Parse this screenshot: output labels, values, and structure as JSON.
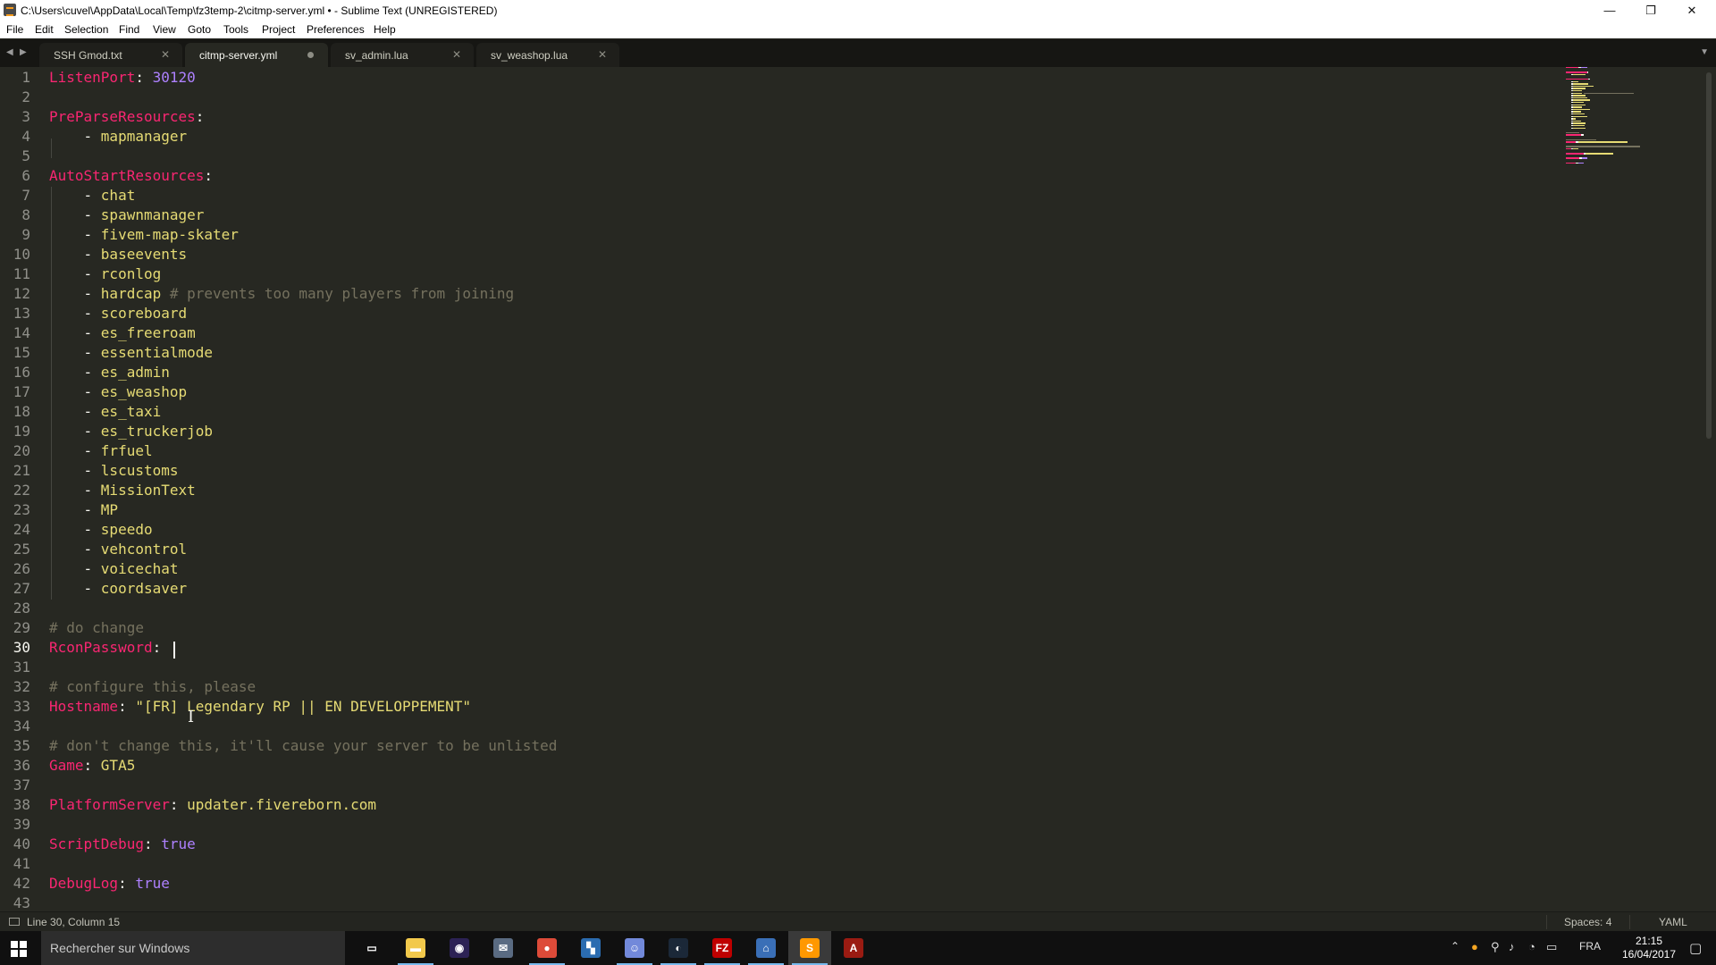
{
  "window": {
    "title": "C:\\Users\\cuvel\\AppData\\Local\\Temp\\fz3temp-2\\citmp-server.yml • - Sublime Text (UNREGISTERED)",
    "minimize_glyph": "—",
    "maximize_glyph": "❐",
    "close_glyph": "✕"
  },
  "menu": [
    "File",
    "Edit",
    "Selection",
    "Find",
    "View",
    "Goto",
    "Tools",
    "Project",
    "Preferences",
    "Help"
  ],
  "tabs": [
    {
      "label": "SSH Gmod.txt",
      "active": false,
      "dirty": false
    },
    {
      "label": "citmp-server.yml",
      "active": true,
      "dirty": true
    },
    {
      "label": "sv_admin.lua",
      "active": false,
      "dirty": false
    },
    {
      "label": "sv_weashop.lua",
      "active": false,
      "dirty": false
    }
  ],
  "editor": {
    "current_line": 30,
    "lines": [
      [
        [
          "k",
          "ListenPort"
        ],
        [
          "p",
          ": "
        ],
        [
          "n",
          "30120"
        ]
      ],
      [],
      [
        [
          "k",
          "PreParseResources"
        ],
        [
          "p",
          ":"
        ]
      ],
      [
        [
          "p",
          "    - "
        ],
        [
          "s",
          "mapmanager"
        ]
      ],
      [],
      [
        [
          "k",
          "AutoStartResources"
        ],
        [
          "p",
          ":"
        ]
      ],
      [
        [
          "p",
          "    - "
        ],
        [
          "s",
          "chat"
        ]
      ],
      [
        [
          "p",
          "    - "
        ],
        [
          "s",
          "spawnmanager"
        ]
      ],
      [
        [
          "p",
          "    - "
        ],
        [
          "s",
          "fivem-map-skater"
        ]
      ],
      [
        [
          "p",
          "    - "
        ],
        [
          "s",
          "baseevents"
        ]
      ],
      [
        [
          "p",
          "    - "
        ],
        [
          "s",
          "rconlog"
        ]
      ],
      [
        [
          "p",
          "    - "
        ],
        [
          "s",
          "hardcap"
        ],
        [
          "c",
          " # prevents too many players from joining"
        ]
      ],
      [
        [
          "p",
          "    - "
        ],
        [
          "s",
          "scoreboard"
        ]
      ],
      [
        [
          "p",
          "    - "
        ],
        [
          "s",
          "es_freeroam"
        ]
      ],
      [
        [
          "p",
          "    - "
        ],
        [
          "s",
          "essentialmode"
        ]
      ],
      [
        [
          "p",
          "    - "
        ],
        [
          "s",
          "es_admin"
        ]
      ],
      [
        [
          "p",
          "    - "
        ],
        [
          "s",
          "es_weashop"
        ]
      ],
      [
        [
          "p",
          "    - "
        ],
        [
          "s",
          "es_taxi"
        ]
      ],
      [
        [
          "p",
          "    - "
        ],
        [
          "s",
          "es_truckerjob"
        ]
      ],
      [
        [
          "p",
          "    - "
        ],
        [
          "s",
          "frfuel"
        ]
      ],
      [
        [
          "p",
          "    - "
        ],
        [
          "s",
          "lscustoms"
        ]
      ],
      [
        [
          "p",
          "    - "
        ],
        [
          "s",
          "MissionText"
        ]
      ],
      [
        [
          "p",
          "    - "
        ],
        [
          "s",
          "MP"
        ]
      ],
      [
        [
          "p",
          "    - "
        ],
        [
          "s",
          "speedo"
        ]
      ],
      [
        [
          "p",
          "    - "
        ],
        [
          "s",
          "vehcontrol"
        ]
      ],
      [
        [
          "p",
          "    - "
        ],
        [
          "s",
          "voicechat"
        ]
      ],
      [
        [
          "p",
          "    - "
        ],
        [
          "s",
          "coordsaver"
        ]
      ],
      [],
      [
        [
          "c",
          "# do change"
        ]
      ],
      [
        [
          "k",
          "RconPassword"
        ],
        [
          "p",
          ": "
        ]
      ],
      [],
      [
        [
          "c",
          "# configure this, please"
        ]
      ],
      [
        [
          "k",
          "Hostname"
        ],
        [
          "p",
          ": "
        ],
        [
          "s",
          "\"[FR] Legendary RP || EN DEVELOPPEMENT\""
        ]
      ],
      [],
      [
        [
          "c",
          "# don't change this, it'll cause your server to be unlisted"
        ]
      ],
      [
        [
          "k",
          "Game"
        ],
        [
          "p",
          ": "
        ],
        [
          "s",
          "GTA5"
        ]
      ],
      [],
      [
        [
          "k",
          "PlatformServer"
        ],
        [
          "p",
          ": "
        ],
        [
          "s",
          "updater.fivereborn.com"
        ]
      ],
      [],
      [
        [
          "k",
          "ScriptDebug"
        ],
        [
          "p",
          ": "
        ],
        [
          "n",
          "true"
        ]
      ],
      [],
      [
        [
          "k",
          "DebugLog"
        ],
        [
          "p",
          ": "
        ],
        [
          "n",
          "true"
        ]
      ],
      []
    ]
  },
  "colors": {
    "keyword": "#f92672",
    "string": "#e6db74",
    "number": "#ae81ff",
    "comment": "#75715e",
    "plain": "#f8f8f2"
  },
  "status": {
    "position": "Line 30, Column 15",
    "spaces": "Spaces: 4",
    "syntax": "YAML"
  },
  "taskbar": {
    "search_placeholder": "Rechercher sur Windows",
    "apps": [
      {
        "name": "task-view-icon",
        "glyph": "▭",
        "bg": "transparent",
        "running": false,
        "active": false
      },
      {
        "name": "file-explorer-icon",
        "glyph": "▬",
        "bg": "#f2c94c",
        "running": true,
        "active": false
      },
      {
        "name": "eclipse-icon",
        "glyph": "◉",
        "bg": "#2c2255",
        "running": false,
        "active": false
      },
      {
        "name": "mail-app-icon",
        "glyph": "✉",
        "bg": "#5a6b82",
        "running": false,
        "active": false
      },
      {
        "name": "chrome-icon",
        "glyph": "●",
        "bg": "#dd4b39",
        "running": true,
        "active": false
      },
      {
        "name": "minecraft-launcher-icon",
        "glyph": "▚",
        "bg": "#2b6cb0",
        "running": false,
        "active": false
      },
      {
        "name": "discord-icon",
        "glyph": "☺",
        "bg": "#7289da",
        "running": true,
        "active": false
      },
      {
        "name": "steam-icon",
        "glyph": "◐",
        "bg": "#1b2838",
        "running": true,
        "active": false
      },
      {
        "name": "filezilla-icon",
        "glyph": "FZ",
        "bg": "#bf0000",
        "running": true,
        "active": false
      },
      {
        "name": "network-tool-icon",
        "glyph": "⌂",
        "bg": "#3a6fb7",
        "running": true,
        "active": false
      },
      {
        "name": "sublime-text-icon",
        "glyph": "S",
        "bg": "#ff9800",
        "running": true,
        "active": true
      },
      {
        "name": "autocad-icon",
        "glyph": "A",
        "bg": "#9a1b12",
        "running": false,
        "active": false
      }
    ],
    "tray": {
      "language": "FRA",
      "time": "21:15",
      "date": "16/04/2017"
    }
  }
}
